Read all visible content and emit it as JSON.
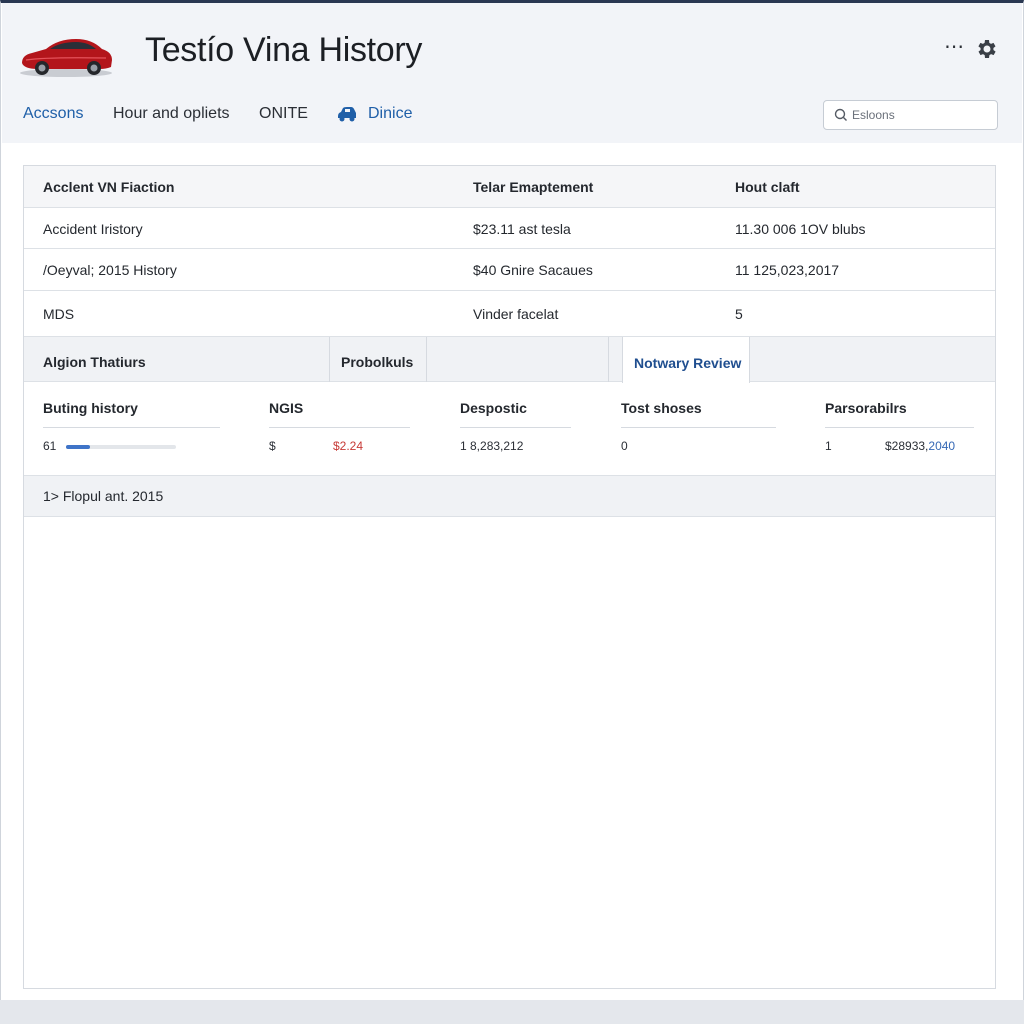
{
  "header": {
    "title": "Testío Vina History",
    "logo_icon": "red-car-logo",
    "more_icon": "more-dots-icon",
    "settings_icon": "gear-icon"
  },
  "nav": {
    "items": [
      {
        "label": "Accsons"
      },
      {
        "label": "Hour and opliets"
      },
      {
        "label": "ONITE"
      },
      {
        "label": "Dinice",
        "icon": "car-icon"
      }
    ],
    "search": {
      "placeholder": "Esloons"
    }
  },
  "table": {
    "headers": [
      "Acclent VN Fiaction",
      "Telar Emaptement",
      "Hout claft"
    ],
    "rows": [
      [
        "Accident Iristory",
        "$23.11 ast tesla",
        "11.30 006 1OV blubs"
      ],
      [
        "/Oeyval; 2015 History",
        "$40 Gnire Sacaues",
        "11 125,023,2017"
      ],
      [
        "MDS",
        "Vinder facelat",
        "5"
      ]
    ]
  },
  "tabs": [
    {
      "label": "Algion Thatiurs"
    },
    {
      "label": "Probolkuls"
    },
    {
      "label": ""
    },
    {
      "label": "Notwary Review",
      "active": true
    }
  ],
  "stats": [
    {
      "label": "Buting history",
      "value": "61",
      "progress": 0.22
    },
    {
      "label": "NGIS",
      "value_prefix": "$",
      "value": "$2.24"
    },
    {
      "label": "Despostic",
      "value": "1 8,283,212"
    },
    {
      "label": "Tost shoses",
      "value": "0"
    },
    {
      "label": "Parsorabilrs",
      "value_prefix": "1",
      "value": "$28933,",
      "value_accent": "2040"
    }
  ],
  "footer": {
    "label": "1> Flopul ant. 2015"
  },
  "colors": {
    "accent": "#1f5fa8",
    "active_tab_text": "#1f4e8f",
    "negative": "#c73a36",
    "progress": "#3f74c8",
    "header_bar": "#2a3852"
  }
}
